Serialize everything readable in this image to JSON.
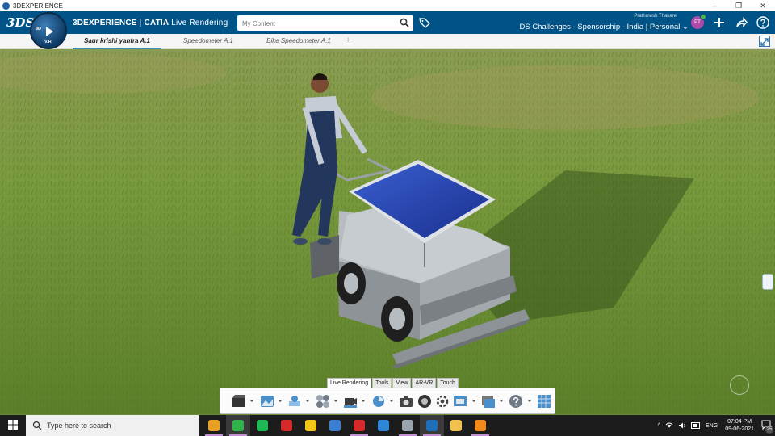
{
  "window": {
    "title": "3DEXPERIENCE",
    "controls": [
      "–",
      "❐",
      "✕"
    ]
  },
  "topbar": {
    "logo": "3DS",
    "brand_bold": "3DEXPERIENCE",
    "brand_sep": "|",
    "brand_app": "CATIA",
    "brand_role": "Live Rendering",
    "search_placeholder": "My Content",
    "user_name": "Prathmesh Thakare",
    "tenant": "DS Challenges - Sponsorship - India | Personal",
    "avatar_initials": "PT",
    "icons": [
      "search-icon",
      "tag-icon",
      "add-icon",
      "share-icon",
      "help-icon"
    ]
  },
  "compass": {
    "label_3d": "3D",
    "label_v": "V.R"
  },
  "tabs": [
    {
      "label": "Saur krishi yantra A.1",
      "active": true
    },
    {
      "label": "Speedometer A.1",
      "active": false
    },
    {
      "label": "Bike Speedometer A.1",
      "active": false
    }
  ],
  "tab_add": "+",
  "action_bar": {
    "tabs": [
      {
        "label": "Live Rendering",
        "active": true
      },
      {
        "label": "Tools",
        "active": false
      },
      {
        "label": "View",
        "active": false
      },
      {
        "label": "AR-VR",
        "active": false
      },
      {
        "label": "Touch",
        "active": false
      }
    ],
    "tools": [
      "animation-icon",
      "environment-icon",
      "lighting-icon",
      "materials-icon",
      "camera-setup-icon",
      "render-icon",
      "snapshot-icon",
      "film-icon",
      "settings-icon",
      "stage-icon",
      "capture-icon",
      "help-icon",
      "grid-icon"
    ]
  },
  "taskbar": {
    "search_placeholder": "Type here to search",
    "apps": [
      {
        "name": "chrome-icon",
        "color": "#e8a020",
        "open": true,
        "active": false
      },
      {
        "name": "chrome-profile-icon",
        "color": "#2fb34a",
        "open": true,
        "active": true
      },
      {
        "name": "spotify-icon",
        "color": "#1db954",
        "open": false,
        "active": false
      },
      {
        "name": "wps-icon",
        "color": "#d42a2a",
        "open": false,
        "active": false
      },
      {
        "name": "sticky-notes-icon",
        "color": "#f5c518",
        "open": false,
        "active": false
      },
      {
        "name": "file-transfer-icon",
        "color": "#3b7fd1",
        "open": false,
        "active": false
      },
      {
        "name": "wps-writer-icon",
        "color": "#d42a2a",
        "open": true,
        "active": false
      },
      {
        "name": "photos-icon",
        "color": "#2f86d9",
        "open": false,
        "active": false
      },
      {
        "name": "media-icon",
        "color": "#9aa5b0",
        "open": true,
        "active": false
      },
      {
        "name": "3dexperience-icon",
        "color": "#1f6fb8",
        "open": true,
        "active": true
      },
      {
        "name": "file-explorer-icon",
        "color": "#f2c14e",
        "open": false,
        "active": false
      },
      {
        "name": "vlc-icon",
        "color": "#f08a1c",
        "open": true,
        "active": false
      }
    ],
    "tray": {
      "chevron": "^",
      "language": "ENG",
      "time": "07:04 PM",
      "date": "09-06-2021",
      "notifications": "25"
    }
  }
}
